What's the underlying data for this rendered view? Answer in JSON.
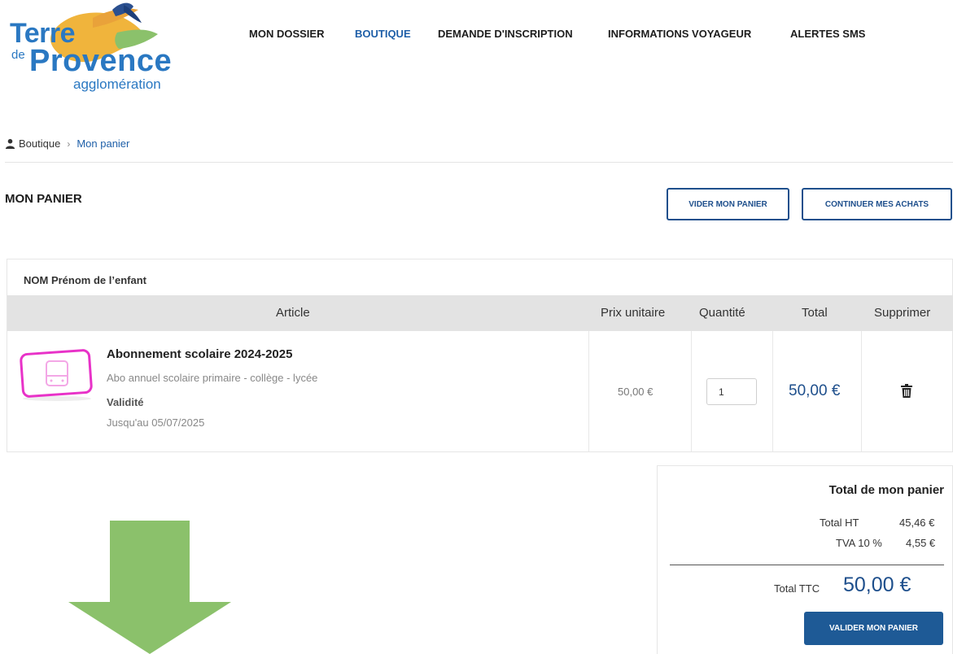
{
  "logo": {
    "line1": "Terre",
    "line2_small": "de",
    "line2": "Provence",
    "line3": "agglomération"
  },
  "nav": {
    "items": [
      {
        "label": "MON DOSSIER",
        "active": false
      },
      {
        "label": "BOUTIQUE",
        "active": true
      },
      {
        "label": "DEMANDE D'INSCRIPTION",
        "active": false
      },
      {
        "label": "INFORMATIONS VOYAGEUR",
        "active": false
      },
      {
        "label": "ALERTES SMS",
        "active": false
      }
    ]
  },
  "breadcrumb": {
    "root": "Boutique",
    "separator": "›",
    "current": "Mon panier"
  },
  "page": {
    "title": "MON PANIER",
    "empty_cart_label": "VIDER MON PANIER",
    "continue_label": "CONTINUER MES ACHATS"
  },
  "cart": {
    "child_name": "NOM Prénom de l’enfant",
    "columns": {
      "article": "Article",
      "unit_price": "Prix unitaire",
      "quantity": "Quantité",
      "total": "Total",
      "delete": "Supprimer"
    },
    "item": {
      "title": "Abonnement scolaire 2024-2025",
      "description": "Abo annuel scolaire primaire - collège - lycée",
      "validity_label": "Validité",
      "validity_date": "Jusqu'au 05/07/2025",
      "unit_price": "50,00 €",
      "quantity": "1",
      "total": "50,00 €"
    }
  },
  "summary": {
    "title": "Total de mon panier",
    "ht_label": "Total HT",
    "ht_value": "45,46 €",
    "tva_label": "TVA 10 %",
    "tva_value": "4,55 €",
    "ttc_label": "Total TTC",
    "ttc_value": "50,00 €",
    "validate_label": "VALIDER MON PANIER"
  },
  "colors": {
    "brand_blue": "#1e4f8c",
    "accent_green": "#8bc16b",
    "icon_magenta": "#e832c8"
  }
}
